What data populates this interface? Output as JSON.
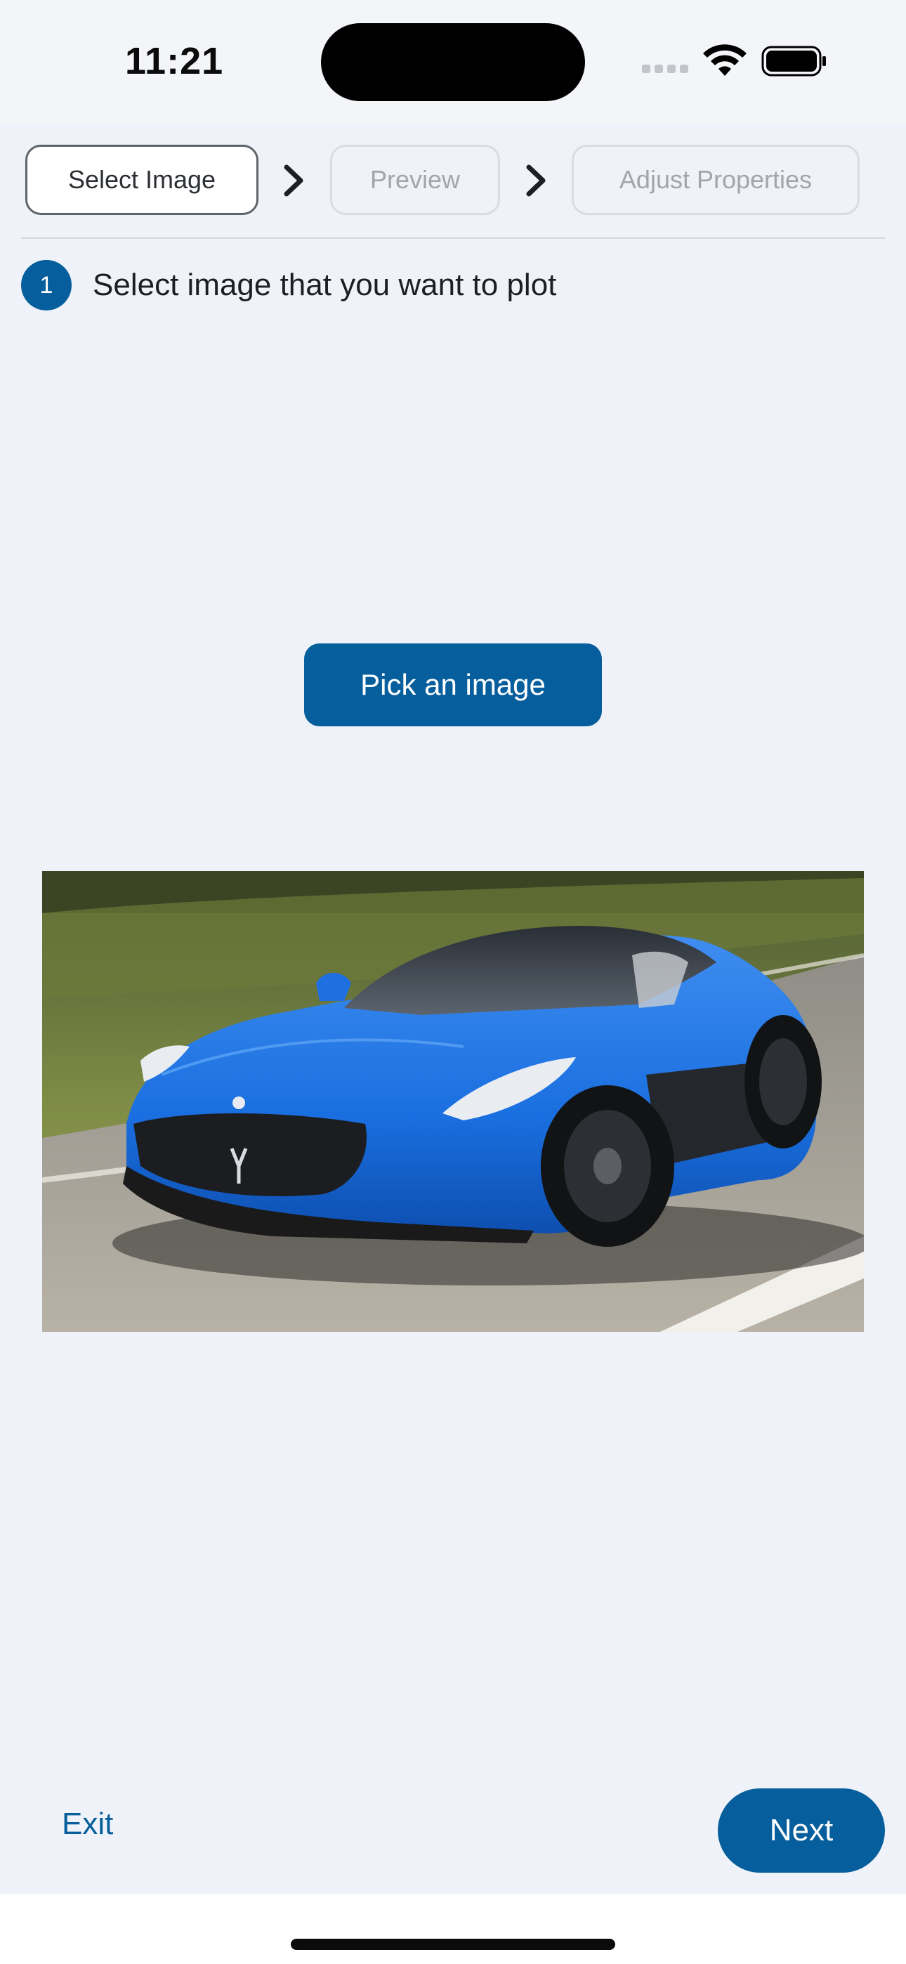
{
  "status_bar": {
    "time": "11:21",
    "icons": [
      "cellular-signal-icon",
      "wifi-icon",
      "battery-icon"
    ]
  },
  "stepper": {
    "steps": [
      {
        "label": "Select Image",
        "state": "active"
      },
      {
        "label": "Preview",
        "state": "inactive"
      },
      {
        "label": "Adjust Properties",
        "state": "inactive"
      }
    ],
    "separator_icon": "chevron-right-icon"
  },
  "instruction": {
    "number": "1",
    "text": "Select image that you want to plot"
  },
  "actions": {
    "pick_label": "Pick an image",
    "exit_label": "Exit",
    "next_label": "Next"
  },
  "image_preview": {
    "subject": "blue sports car on road"
  },
  "colors": {
    "accent": "#065e9c",
    "background": "#eff3f9",
    "active_step_border": "#5f646b",
    "inactive_step_text": "#a2a6ac"
  }
}
